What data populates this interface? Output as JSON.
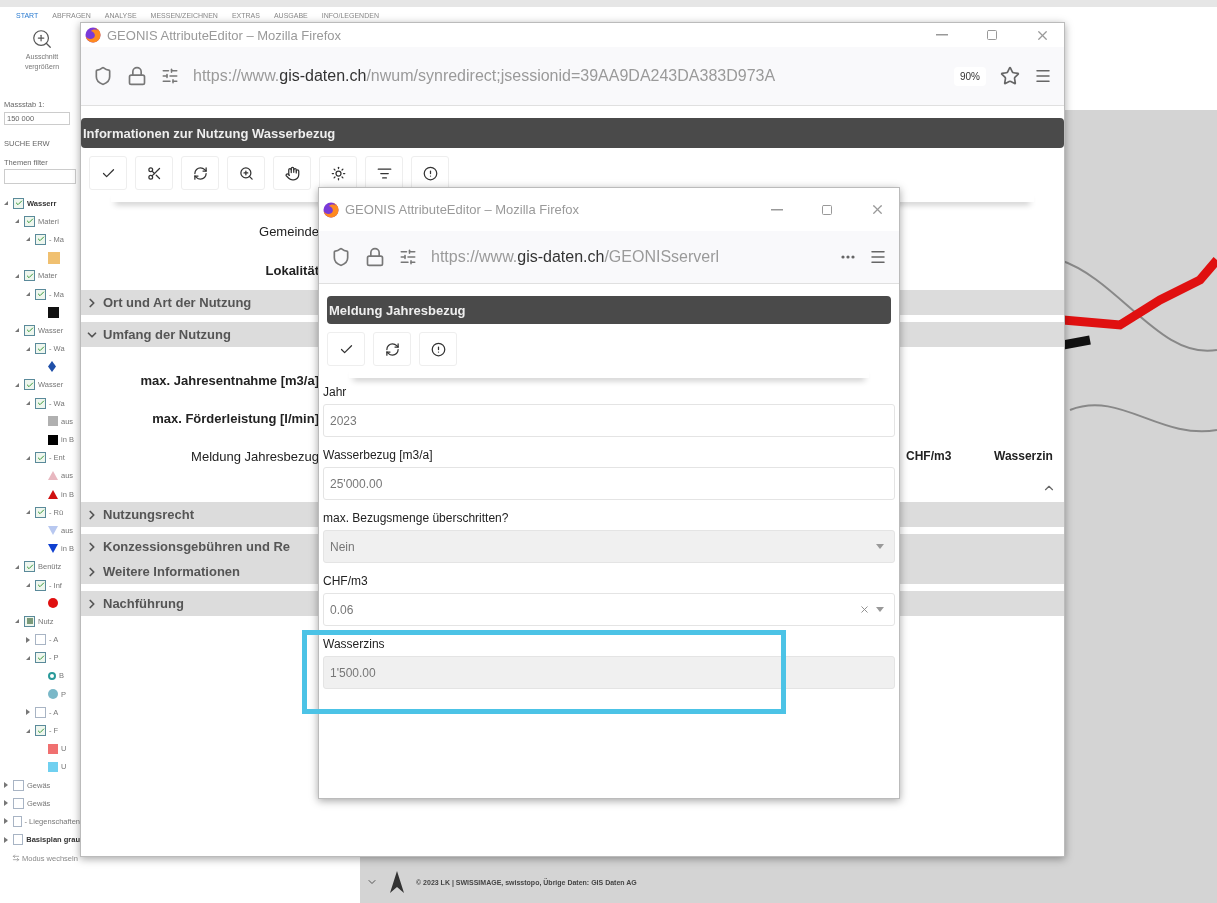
{
  "background_app": {
    "menu": [
      {
        "label": "START",
        "selected": true
      },
      {
        "label": "ABFRAGEN",
        "selected": false
      },
      {
        "label": "ANALYSE",
        "selected": false
      },
      {
        "label": "MESSEN/ZEICHNEN",
        "selected": false
      },
      {
        "label": "EXTRAS",
        "selected": false
      },
      {
        "label": "AUSGABE",
        "selected": false
      },
      {
        "label": "INFO/LEGENDEN",
        "selected": false
      }
    ],
    "sidebar": {
      "zoom_lines": [
        "Ausschnitt",
        "vergrößern"
      ],
      "scale_label": "Massstab 1:",
      "scale_value": "150 000",
      "search_label": "SUCHE ERW",
      "filter_label": "Themen filter",
      "tree": [
        {
          "label": "Wasserr",
          "bold": true,
          "checked": true,
          "mixed": false,
          "expanded": true,
          "children": [
            {
              "label": "Materi",
              "bold": false,
              "checked": true,
              "mixed": false,
              "expanded": true,
              "children": [
                {
                  "label": "- Ma",
                  "bold": false,
                  "checked": true,
                  "mixed": false,
                  "expanded": true,
                  "legend": [
                    {
                      "kind": "hatch",
                      "color": "#f0c070"
                    }
                  ]
                }
              ]
            },
            {
              "label": "Mater",
              "bold": false,
              "checked": true,
              "mixed": false,
              "expanded": true,
              "children": [
                {
                  "label": "- Ma",
                  "bold": false,
                  "checked": true,
                  "mixed": false,
                  "expanded": true,
                  "legend": [
                    {
                      "kind": "pattern",
                      "color": "#111111"
                    }
                  ]
                }
              ]
            },
            {
              "label": "Wasser",
              "bold": false,
              "checked": true,
              "mixed": false,
              "expanded": true,
              "children": [
                {
                  "label": "- Wa",
                  "bold": false,
                  "checked": true,
                  "mixed": false,
                  "expanded": true,
                  "legend": [
                    {
                      "kind": "diamond",
                      "color": "#1f4fa8"
                    }
                  ]
                }
              ]
            },
            {
              "label": "Wasser",
              "bold": false,
              "checked": true,
              "mixed": false,
              "expanded": true,
              "children": [
                {
                  "label": "- Wa",
                  "bold": false,
                  "checked": true,
                  "mixed": false,
                  "expanded": true,
                  "legend": [
                    {
                      "kind": "square",
                      "color": "#b0b0b0",
                      "label": "aus"
                    },
                    {
                      "kind": "square",
                      "color": "#000000",
                      "label": "in B"
                    }
                  ]
                },
                {
                  "label": "- Ent",
                  "bold": false,
                  "checked": true,
                  "mixed": false,
                  "expanded": true,
                  "legend": [
                    {
                      "kind": "triangle",
                      "color": "#e8b8c0",
                      "label": "aus"
                    },
                    {
                      "kind": "triangle",
                      "color": "#d01010",
                      "label": "in B"
                    }
                  ]
                },
                {
                  "label": "- Rü",
                  "bold": false,
                  "checked": true,
                  "mixed": false,
                  "expanded": true,
                  "legend": [
                    {
                      "kind": "triangle-down",
                      "color": "#b8c8f0",
                      "label": "aus"
                    },
                    {
                      "kind": "triangle-down",
                      "color": "#1040d0",
                      "label": "in B"
                    }
                  ]
                }
              ]
            },
            {
              "label": "Benütz",
              "bold": false,
              "checked": true,
              "mixed": false,
              "expanded": true,
              "children": [
                {
                  "label": "- Inf",
                  "bold": false,
                  "checked": true,
                  "mixed": false,
                  "expanded": true,
                  "legend": [
                    {
                      "kind": "dot",
                      "color": "#e01010"
                    }
                  ]
                }
              ]
            },
            {
              "label": "Nutz",
              "bold": false,
              "checked": true,
              "mixed": true,
              "expanded": true,
              "children": [
                {
                  "label": "- A",
                  "bold": false,
                  "checked": false,
                  "mixed": false,
                  "expanded": false
                },
                {
                  "label": "- P",
                  "bold": false,
                  "checked": true,
                  "mixed": false,
                  "expanded": true,
                  "legend": [
                    {
                      "kind": "ring",
                      "color": "#2a9a9a",
                      "label": "B"
                    },
                    {
                      "kind": "dot",
                      "color": "#7ab8c8",
                      "label": "P"
                    }
                  ]
                },
                {
                  "label": "- A",
                  "bold": false,
                  "checked": false,
                  "mixed": false,
                  "expanded": false
                },
                {
                  "label": "- F",
                  "bold": false,
                  "checked": true,
                  "mixed": false,
                  "expanded": true,
                  "legend": [
                    {
                      "kind": "square",
                      "color": "#f07070",
                      "label": "U"
                    },
                    {
                      "kind": "square",
                      "color": "#70d0f0",
                      "label": "U"
                    }
                  ]
                }
              ]
            }
          ]
        },
        {
          "label": "Gewäs",
          "bold": false,
          "checked": false,
          "mixed": false,
          "expanded": false
        },
        {
          "label": "Gewäs",
          "bold": false,
          "checked": false,
          "mixed": false,
          "expanded": false
        },
        {
          "label": "- Liegenschaften",
          "bold": false,
          "checked": false,
          "mixed": false,
          "expanded": false
        },
        {
          "label": "Basisplan grau",
          "bold": true,
          "checked": false,
          "mixed": false,
          "expanded": false
        }
      ],
      "mode_link": "Modus wechseln"
    },
    "map": {
      "attribution": "© 2023 LK | SWISSIMAGE, swisstopo, Übrige Daten: GIS Daten AG"
    }
  },
  "main_window": {
    "title": "GEONIS AttributeEditor – Mozilla Firefox",
    "url": "https://www.**gis-daten.ch**/nwum/synredirect;jsessionid=39AA9DA243DA383D973A",
    "zoom": "90%",
    "header": "Informationen zur Nutzung Wasserbezug",
    "toolbar": [
      {
        "kind": "check"
      },
      {
        "kind": "cut"
      },
      {
        "kind": "refresh"
      },
      {
        "kind": "zoom"
      },
      {
        "kind": "pan"
      },
      {
        "kind": "highlight"
      },
      {
        "kind": "filter"
      },
      {
        "kind": "alert"
      }
    ],
    "form": [
      {
        "kind": "field",
        "label": "Gemeinde",
        "bold": false
      },
      {
        "kind": "field",
        "label": "Lokalität",
        "bold": true
      },
      {
        "kind": "section",
        "label": "Ort und Art der Nutzung",
        "expanded": false
      },
      {
        "kind": "section",
        "label": "Umfang der Nutzung",
        "expanded": true,
        "rows": [
          {
            "kind": "field",
            "label": "max. Jahresentnahme [m3/a]",
            "bold": true
          },
          {
            "kind": "field",
            "label": "max. Förderleistung [l/min]",
            "bold": true
          },
          {
            "kind": "table",
            "label": "Meldung Jahresbezug",
            "bold": false,
            "columns": [
              "CHF/m3",
              "Wasserzin"
            ]
          }
        ]
      },
      {
        "kind": "section",
        "label": "Nutzungsrecht",
        "expanded": false
      },
      {
        "kind": "section",
        "label": "Konzessionsgebühren und Re",
        "expanded": false
      },
      {
        "kind": "section",
        "label": "Weitere Informationen",
        "expanded": false
      },
      {
        "kind": "section",
        "label": "Nachführung",
        "expanded": false
      }
    ]
  },
  "dialog_window": {
    "title": "GEONIS AttributeEditor – Mozilla Firefox",
    "url": "https://www.**gis-daten.ch**/GEONISserverl",
    "header": "Meldung Jahresbezug",
    "toolbar": [
      {
        "kind": "check"
      },
      {
        "kind": "refresh"
      },
      {
        "kind": "alert"
      }
    ],
    "fields": [
      {
        "kind": "text",
        "label": "Jahr",
        "value": "2023",
        "highlighted": false
      },
      {
        "kind": "text",
        "label": "Wasserbezug [m3/a]",
        "value": "25'000.00",
        "highlighted": false
      },
      {
        "kind": "select",
        "label": "max. Bezugsmenge überschritten?",
        "value": "Nein",
        "highlighted": false
      },
      {
        "kind": "combo",
        "label": "CHF/m3",
        "value": "0.06",
        "highlighted": false
      },
      {
        "kind": "readonly",
        "label": "Wasserzins",
        "value": "1'500.00",
        "highlighted": true
      }
    ]
  }
}
